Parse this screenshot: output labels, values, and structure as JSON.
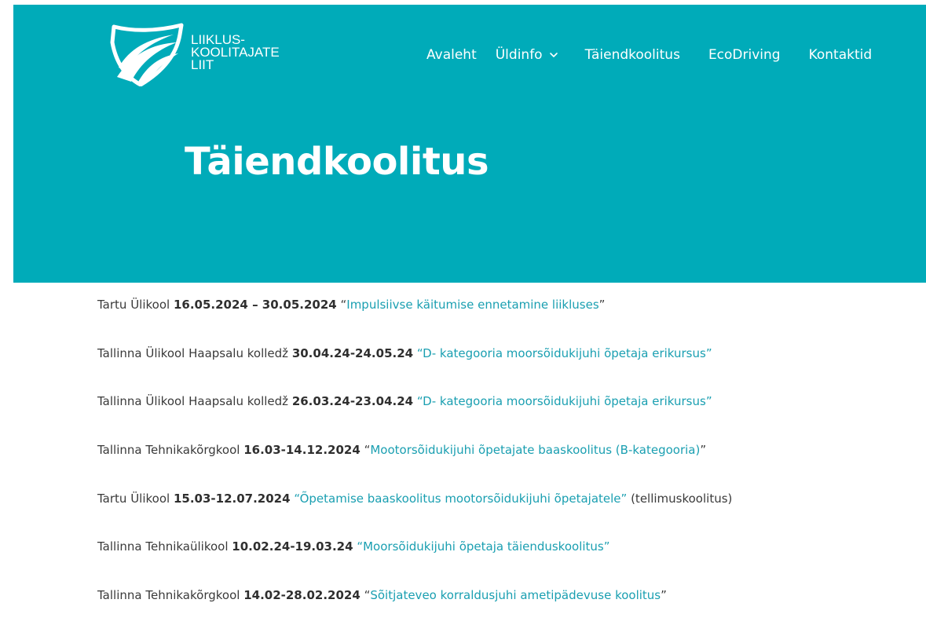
{
  "header": {
    "logo_lines": [
      "LIIKLUS-",
      "KOOLITAJATE",
      "LIIT"
    ],
    "nav": [
      {
        "label": "Avaleht"
      },
      {
        "label": "Üldinfo",
        "has_dropdown": true
      },
      {
        "label": "Täiendkoolitus"
      },
      {
        "label": "EcoDriving"
      },
      {
        "label": "Kontaktid"
      }
    ]
  },
  "page": {
    "title": "Täiendkoolitus"
  },
  "colors": {
    "hero_background": "#00abb9",
    "link": "#1a9fb1",
    "text": "#3a3a3a"
  },
  "events": [
    {
      "institution": "Tartu Ülikool",
      "dates": "16.05.2024 – 30.05.2024",
      "sep": " ",
      "open_quote": "“",
      "title": "Impulsiivse käitumise ennetamine liikluses",
      "close_quote": "”",
      "note": ""
    },
    {
      "institution": "Tallinna Ülikool Haapsalu kolledž",
      "dates": "30.04.24-24.05.24",
      "sep": "  ",
      "open_quote": "",
      "title": "“D- kategooria moorsõidukijuhi õpetaja erikursus”",
      "close_quote": "",
      "note": ""
    },
    {
      "institution": "Tallinna Ülikool Haapsalu kolledž",
      "dates": "26.03.24-23.04.24",
      "sep": "  ",
      "open_quote": "",
      "title": "“D- kategooria moorsõidukijuhi õpetaja erikursus”",
      "close_quote": "",
      "note": ""
    },
    {
      "institution": "Tallinna Tehnikakõrgkool",
      "dates": "16.03-14.12.2024",
      "sep": " ",
      "open_quote": "“",
      "title": "Mootorsõidukijuhi õpetajate baaskoolitus (B-kategooria)",
      "close_quote": "”",
      "note": ""
    },
    {
      "institution": "Tartu Ülikool",
      "dates": "15.03-12.07.2024",
      "sep": " ",
      "open_quote": "",
      "title": "“Õpetamise baaskoolitus  mootorsõidukijuhi õpetajatele”",
      "close_quote": "",
      "note": " (tellimuskoolitus)"
    },
    {
      "institution": "Tallinna Tehnikaülikool",
      "dates": "10.02.24-19.03.24",
      "sep": "  ",
      "open_quote": "",
      "title": "“Moorsõidukijuhi õpetaja täienduskoolitus”",
      "close_quote": "",
      "note": ""
    },
    {
      "institution": "Tallinna Tehnikakõrgkool",
      "dates": "14.02-28.02.2024",
      "sep": " ",
      "open_quote": "“",
      "title": "Sõitjateveo korraldusjuhi ametipädevuse koolitus",
      "close_quote": "”",
      "note": ""
    }
  ]
}
